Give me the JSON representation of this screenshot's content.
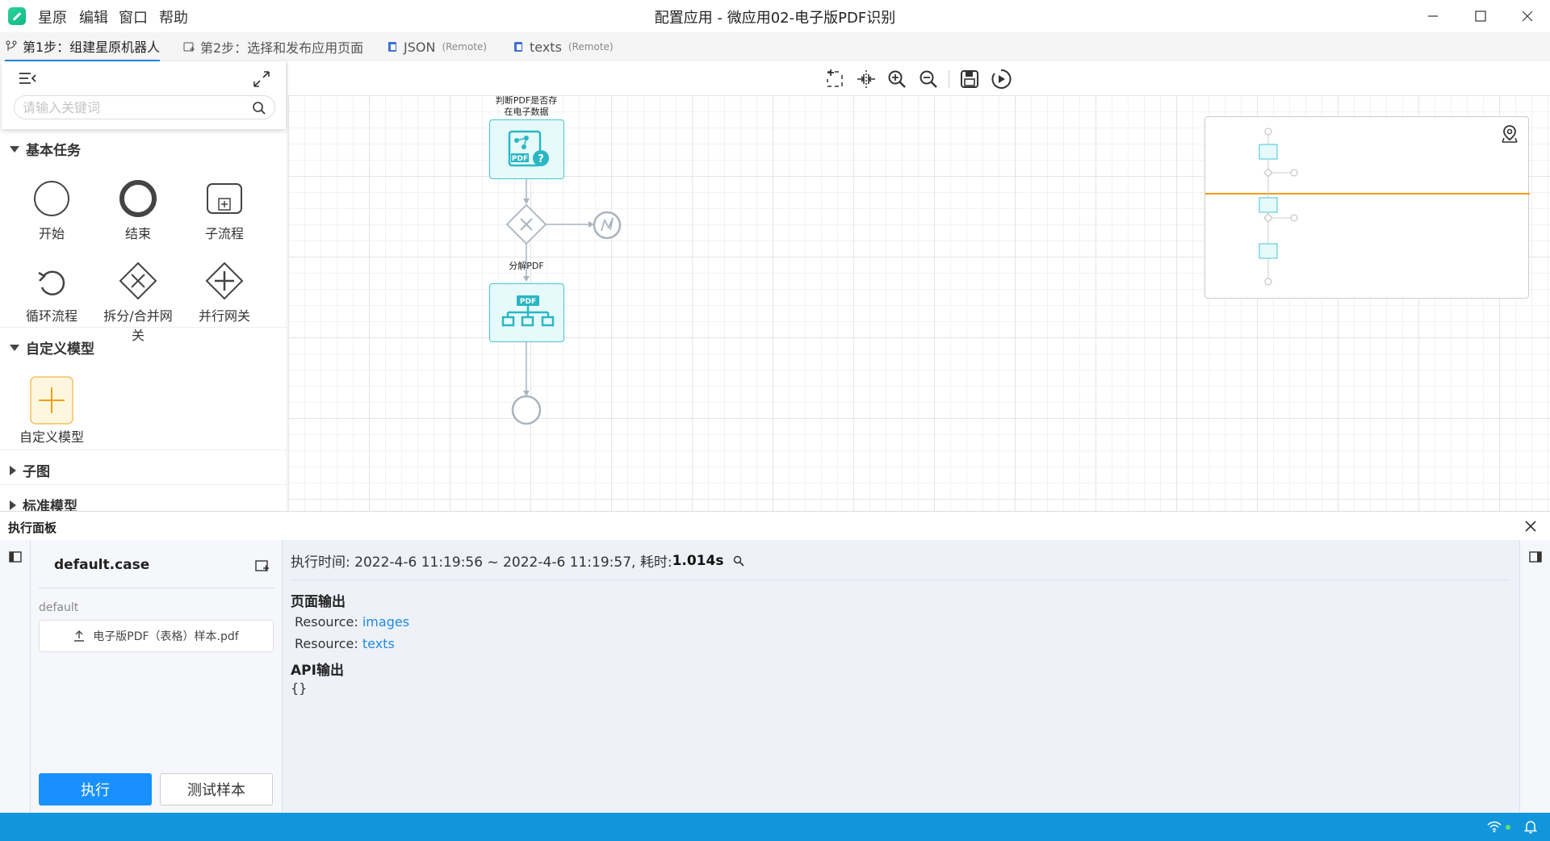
{
  "menu": {
    "items": [
      "星原",
      "编辑",
      "窗口",
      "帮助"
    ]
  },
  "window": {
    "title": "配置应用 - 微应用02-电子版PDF识别"
  },
  "tabs": [
    {
      "label": "第1步：组建星原机器人",
      "sub": ""
    },
    {
      "label": "第2步：选择和发布应用页面",
      "sub": ""
    },
    {
      "label": "JSON",
      "sub": "(Remote)"
    },
    {
      "label": "texts",
      "sub": "(Remote)"
    }
  ],
  "left_panel": {
    "search": {
      "placeholder": "请输入关键词"
    },
    "sections": {
      "basic": {
        "title": "基本任务"
      },
      "custom": {
        "title": "自定义模型"
      },
      "subgraph": {
        "title": "子图"
      },
      "standard": {
        "title": "标准模型"
      }
    },
    "tools": {
      "start": "开始",
      "end": "结束",
      "subprocess": "子流程",
      "loop": "循环流程",
      "split_merge": "拆分/合并网关",
      "parallel": "并行网关",
      "custom_model": "自定义模型"
    }
  },
  "diagram": {
    "node1": {
      "label_line1": "判断PDF是否存",
      "label_line2": "在电子数据",
      "badge": "PDF"
    },
    "node2": {
      "label": "分解PDF",
      "badge": "PDF"
    }
  },
  "exec_panel": {
    "title": "执行面板",
    "case": {
      "name": "default.case",
      "group": "default",
      "file": "电子版PDF（表格）样本.pdf",
      "run_label": "执行",
      "test_label": "测试样本"
    },
    "output": {
      "time_prefix": "执行时间: 2022-4-6 11:19:56 ~ 2022-4-6 11:19:57, 耗时: ",
      "duration": "1.014s",
      "page_output_title": "页面输出",
      "resource_label": "Resource: ",
      "resources": [
        "images",
        "texts"
      ],
      "api_output_title": "API输出",
      "api_output_value": "{}"
    }
  },
  "colors": {
    "accent": "#1890ff",
    "statusbar": "#1296db",
    "node": "#3cc5d0",
    "minimap_line": "#f39c12"
  }
}
